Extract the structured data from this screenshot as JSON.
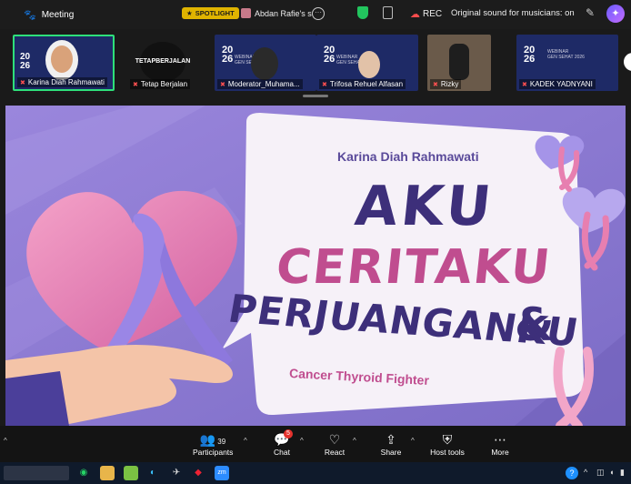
{
  "app": {
    "title": "Meeting"
  },
  "spotlight": {
    "badge": "SPOTLIGHT",
    "name": "Abdan Rafie's s"
  },
  "recording": {
    "label": "REC",
    "sound": "Original sound for musicians: on"
  },
  "participants_strip": [
    {
      "name": "Karina Diah Rahmawati",
      "active": true
    },
    {
      "name": "Tetap Berjalan"
    },
    {
      "name": "Moderator_Muhama..."
    },
    {
      "name": "Trifosa Rehuel Alfasan"
    },
    {
      "name": "Rizky"
    },
    {
      "name": "KADEK YADNYANI"
    }
  ],
  "tile_texts": {
    "year_top": "20",
    "year_bottom": "26",
    "webinar": "WEBINAR",
    "gen_sehat": "GEN SEHAT",
    "gen_sehat_2026": "GEN SEHAT 2026",
    "tetap_line1": "TETAP",
    "tetap_line2": "BERJALAN"
  },
  "slide": {
    "speaker": "Karina Diah Rahmawati",
    "line1": "AKU",
    "line2": "CERITAKU",
    "amp": "&",
    "line3": "PERJUANGANKU",
    "subtitle": "Cancer Thyroid Fighter"
  },
  "controls": {
    "participants": {
      "label": "Participants",
      "count": "39"
    },
    "chat": {
      "label": "Chat",
      "badge": "5"
    },
    "react": {
      "label": "React"
    },
    "share": {
      "label": "Share"
    },
    "host_tools": {
      "label": "Host tools"
    },
    "more": {
      "label": "More"
    }
  },
  "colors": {
    "accent_green": "#2ee07a",
    "slide_bg": "#8c7ad1",
    "title_purple": "#3d2f7a",
    "title_pink": "#c04d8f",
    "spotlight": "#e0b400"
  }
}
